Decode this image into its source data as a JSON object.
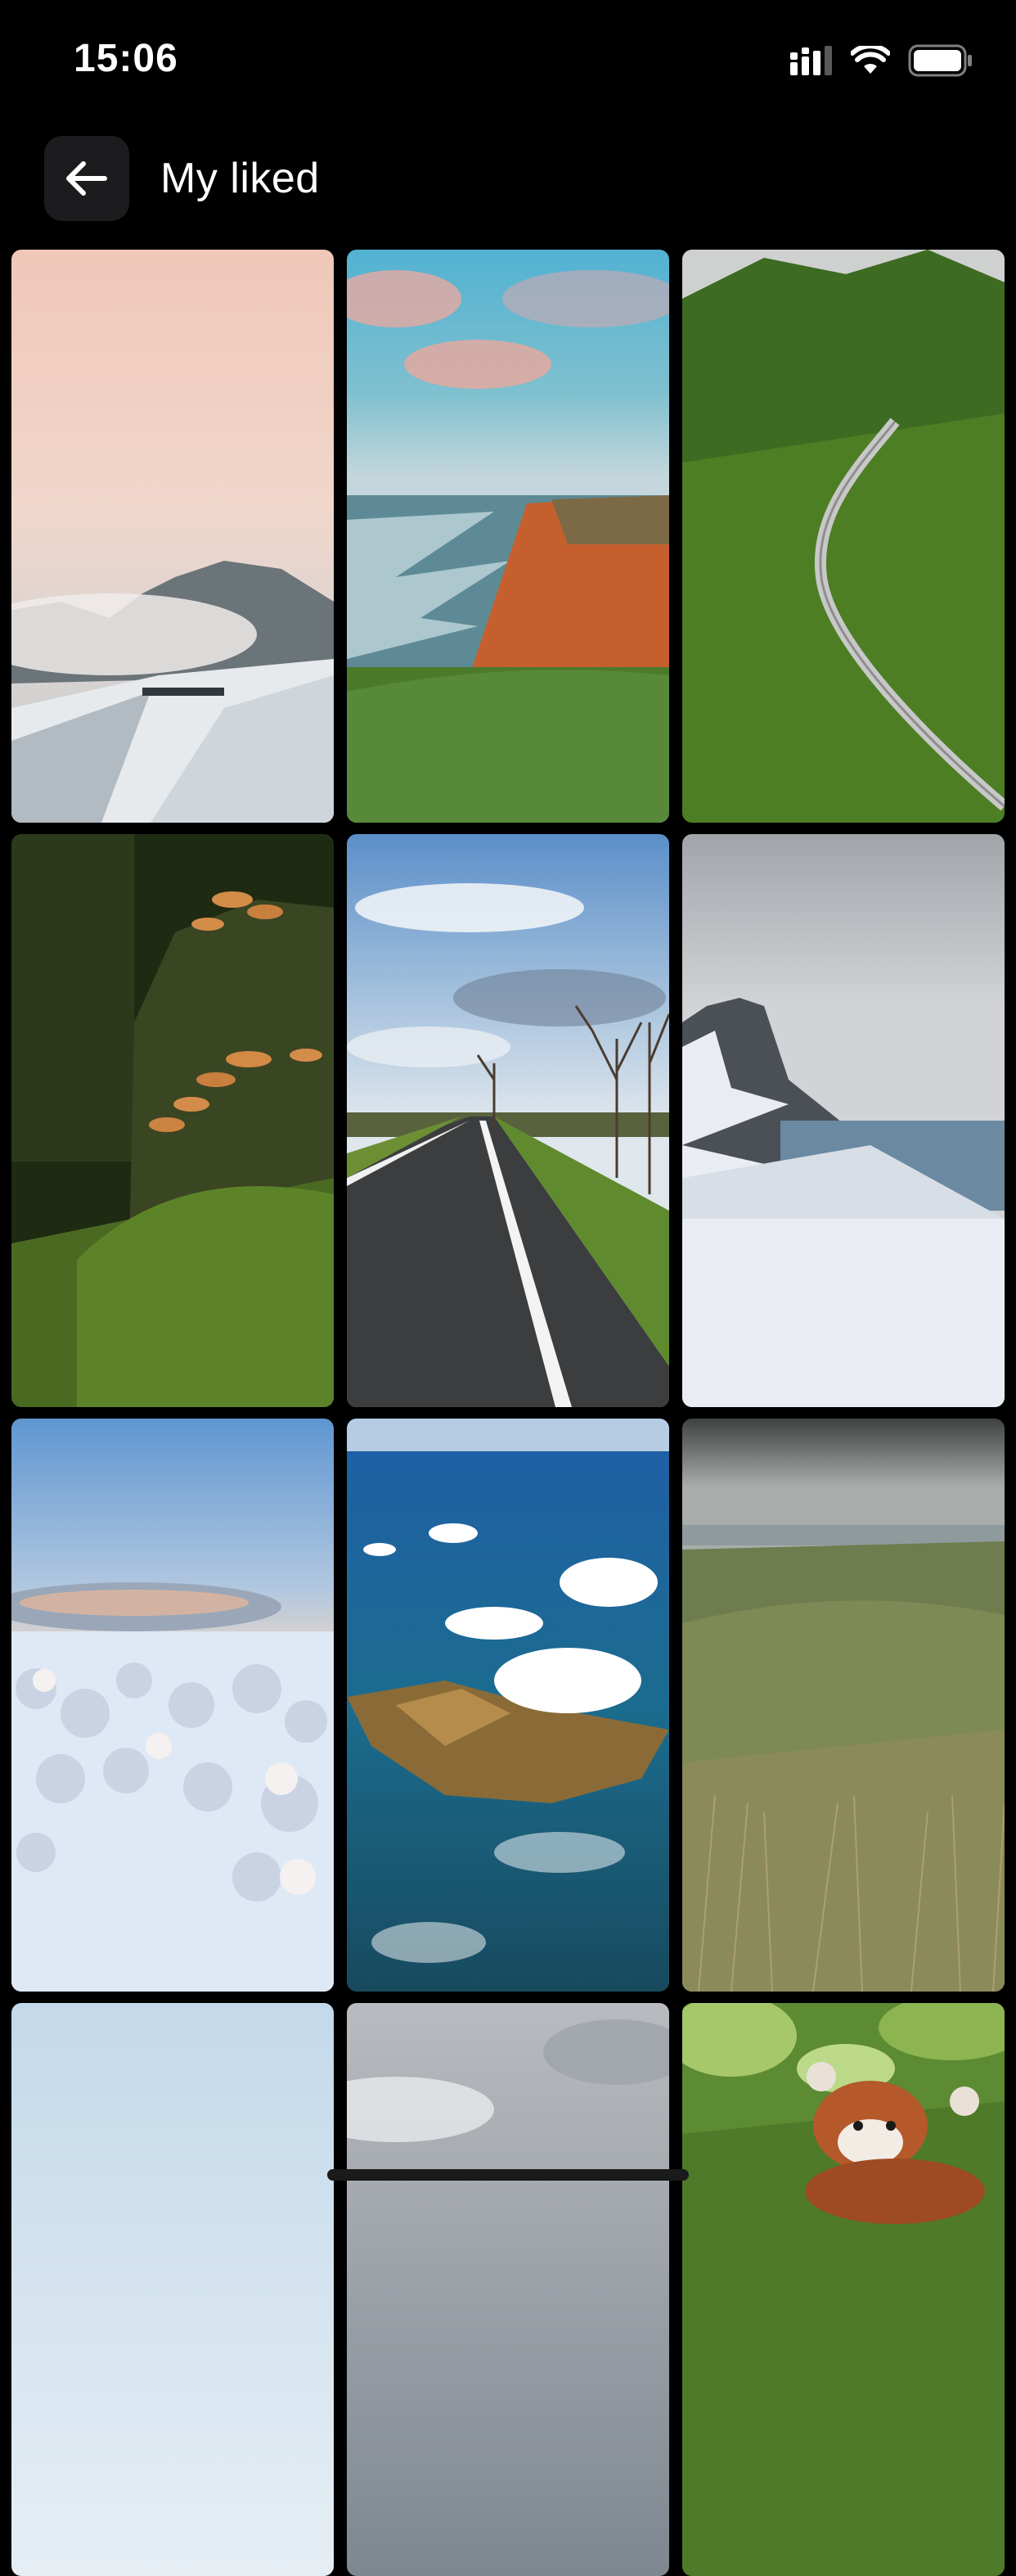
{
  "status_bar": {
    "time": "15:06",
    "icons": [
      "signal-icon",
      "wifi-icon",
      "battery-icon"
    ]
  },
  "header": {
    "back_icon": "arrow-left-icon",
    "title": "My liked"
  },
  "grid": {
    "tiles": [
      {
        "name": "snowy-mountain-sunrise"
      },
      {
        "name": "coastal-cliff-beach"
      },
      {
        "name": "green-mountain-highway"
      },
      {
        "name": "forest-mushrooms"
      },
      {
        "name": "country-road-trees"
      },
      {
        "name": "snowy-peak-seaside"
      },
      {
        "name": "frosted-winter-forest"
      },
      {
        "name": "aerial-island-clouds"
      },
      {
        "name": "grassy-dunes"
      },
      {
        "name": "pale-sky"
      },
      {
        "name": "grey-clouds"
      },
      {
        "name": "red-panda"
      }
    ]
  },
  "colors": {
    "background": "#000000",
    "button_bg": "#1c1c1e",
    "text": "#ffffff"
  }
}
